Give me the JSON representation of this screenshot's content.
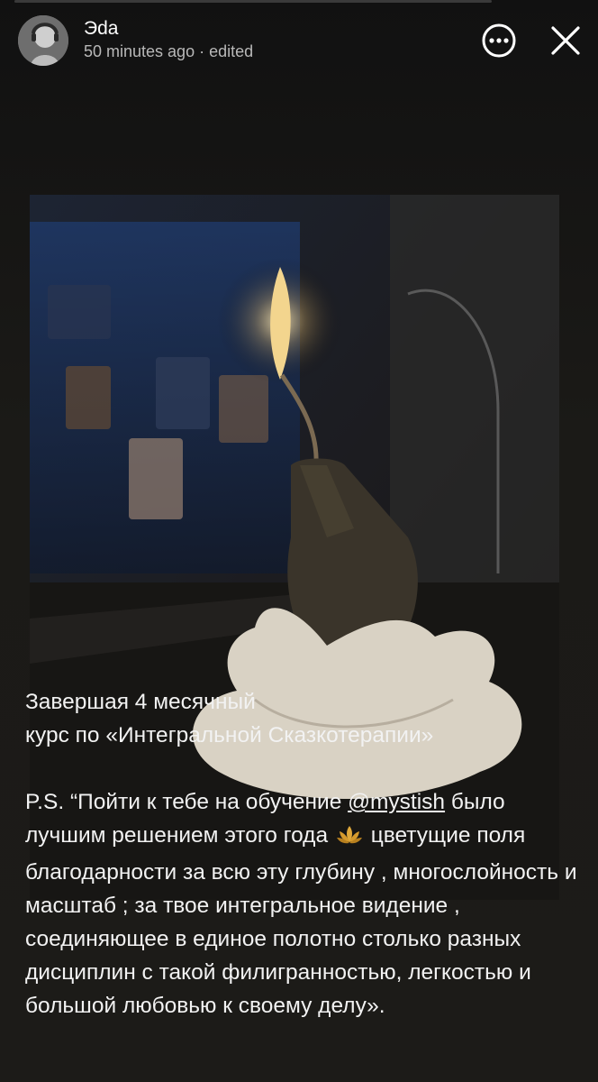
{
  "header": {
    "username": "Эda",
    "time": "50 minutes ago",
    "separator": "·",
    "edited": "edited",
    "more_icon": "ellipsis-circle-icon",
    "close_icon": "close-x-icon"
  },
  "story": {
    "image_alt": "candle-hand-photo"
  },
  "caption": {
    "line1": "Завершая 4 месячный",
    "line2": "курс по «Интегральной Сказкотерапии»",
    "ps_start": "P.S. “Пойти к тебе на обучение ",
    "mention": "@mystish",
    "ps_mid": " было лучшим решением этого года ",
    "emoji": "lotus-icon",
    "ps_end": " цветущие поля благодарности за всю эту глубину , многослойность и масштаб ; за твое интегральное видение , соединяющее в единое полотно столько разных дисциплин с такой филигранностью, легкостью и большой любовью к своему делу»."
  }
}
